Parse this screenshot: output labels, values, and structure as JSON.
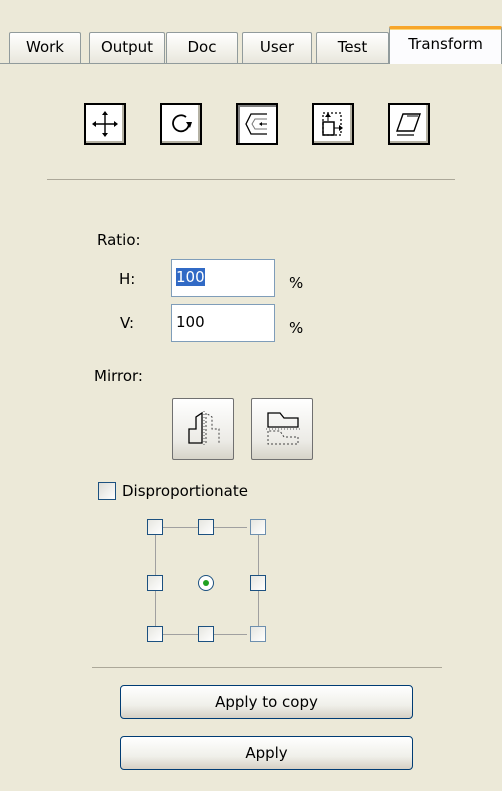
{
  "tabs": [
    {
      "label": "Work"
    },
    {
      "label": "Output"
    },
    {
      "label": "Doc"
    },
    {
      "label": "User"
    },
    {
      "label": "Test"
    },
    {
      "label": "Transform",
      "active": true
    }
  ],
  "transform_tools": [
    {
      "icon": "move-icon"
    },
    {
      "icon": "rotate-icon"
    },
    {
      "icon": "scale-icon",
      "pressed": true
    },
    {
      "icon": "size-icon"
    },
    {
      "icon": "skew-icon"
    }
  ],
  "ratio": {
    "label": "Ratio:",
    "h_label": "H:",
    "h_value": "100",
    "v_label": "V:",
    "v_value": "100",
    "unit": "%"
  },
  "mirror": {
    "label": "Mirror:"
  },
  "disproportionate": {
    "label": "Disproportionate",
    "checked": false
  },
  "anchor_grid": {
    "selected": "center"
  },
  "buttons": {
    "apply_to_copy": "Apply to copy",
    "apply": "Apply"
  }
}
